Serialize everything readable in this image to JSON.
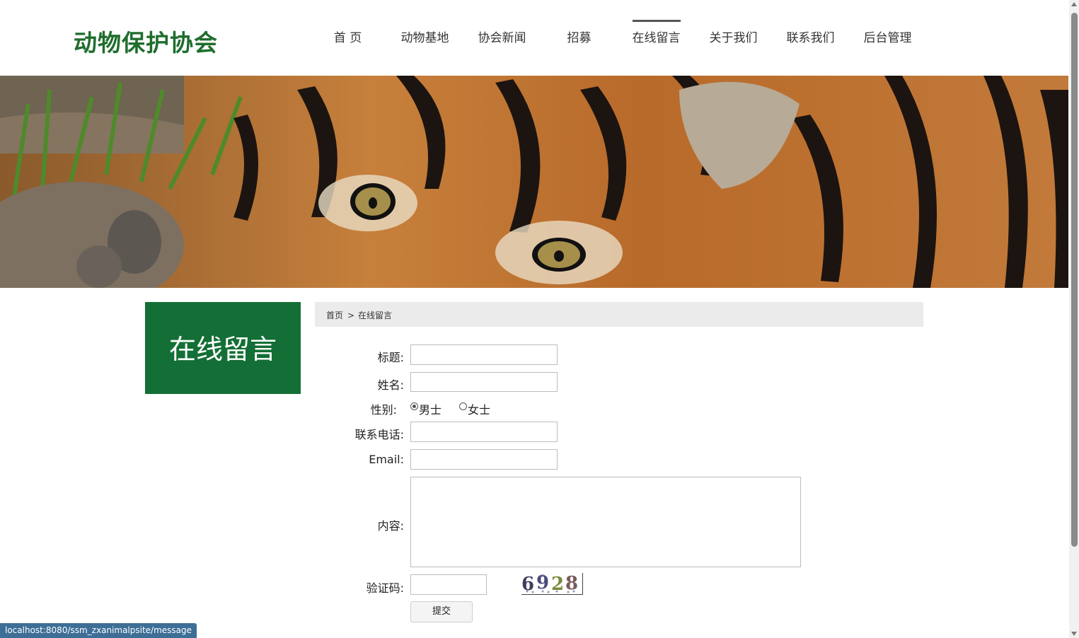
{
  "header": {
    "logo": "动物保护协会",
    "nav": [
      {
        "label": "首 页"
      },
      {
        "label": "动物基地"
      },
      {
        "label": "协会新闻"
      },
      {
        "label": "招募"
      },
      {
        "label": "在线留言",
        "active": true
      },
      {
        "label": "关于我们"
      },
      {
        "label": "联系我们"
      },
      {
        "label": "后台管理"
      }
    ]
  },
  "hero": {
    "image": "tiger-banner"
  },
  "sidebar": {
    "title": "在线留言"
  },
  "breadcrumb": {
    "home": "首页",
    "separator": ">",
    "current": "在线留言"
  },
  "form": {
    "title_label": "标题:",
    "title_value": "",
    "name_label": "姓名:",
    "name_value": "",
    "gender_label": "性别:",
    "gender_options": [
      "男士",
      "女士"
    ],
    "gender_selected": "男士",
    "phone_label": "联系电话:",
    "phone_value": "",
    "email_label": "Email:",
    "email_value": "",
    "content_label": "内容:",
    "content_value": "",
    "captcha_label": "验证码:",
    "captcha_value": "",
    "captcha_text": "6928",
    "submit_label": "提交"
  },
  "status_bar": {
    "url": "localhost:8080/ssm_zxanimalpsite/message"
  },
  "colors": {
    "brand": "#136f35",
    "logo": "#1f6d2d",
    "status": "#3d6e96"
  }
}
